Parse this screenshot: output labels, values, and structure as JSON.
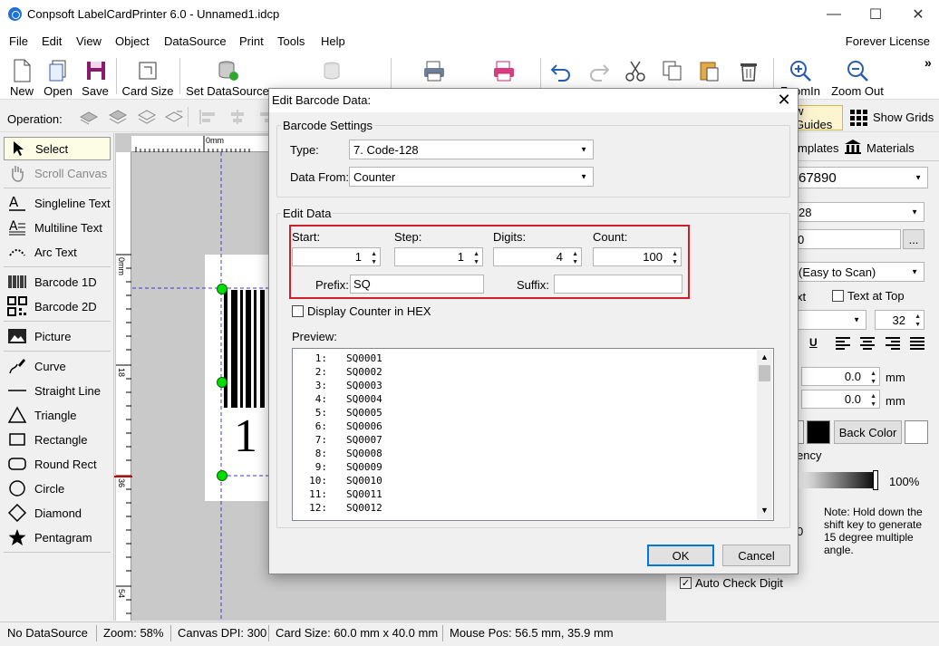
{
  "window": {
    "title": "Conpsoft LabelCardPrinter 6.0 - Unnamed1.idcp",
    "minimize": "—",
    "maximize": "☐",
    "close": "✕"
  },
  "menu": {
    "items": [
      "File",
      "Edit",
      "View",
      "Object",
      "DataSource",
      "Print",
      "Tools",
      "Help"
    ],
    "license": "Forever License"
  },
  "toolbar": {
    "new": "New",
    "open": "Open",
    "save": "Save",
    "card_size": "Card Size",
    "set_datasource": "Set DataSource",
    "zoom_in": "ZoomIn",
    "zoom_out": "Zoom Out",
    "overflow": "»"
  },
  "operation": {
    "label": "Operation:"
  },
  "tools": [
    {
      "label": "Select",
      "icon": "arrow-cursor-icon"
    },
    {
      "label": "Scroll Canvas",
      "icon": "hand-icon"
    },
    {
      "label": "Singleline Text",
      "icon": "singleline-text-icon"
    },
    {
      "label": "Multiline Text",
      "icon": "multiline-text-icon"
    },
    {
      "label": "Arc Text",
      "icon": "arc-text-icon"
    },
    {
      "label": "Barcode 1D",
      "icon": "barcode-icon"
    },
    {
      "label": "Barcode 2D",
      "icon": "qrcode-icon"
    },
    {
      "label": "Picture",
      "icon": "picture-icon"
    },
    {
      "label": "Curve",
      "icon": "curve-icon"
    },
    {
      "label": "Straight Line",
      "icon": "line-icon"
    },
    {
      "label": "Triangle",
      "icon": "triangle-icon"
    },
    {
      "label": "Rectangle",
      "icon": "rectangle-icon"
    },
    {
      "label": "Round Rect",
      "icon": "round-rect-icon"
    },
    {
      "label": "Circle",
      "icon": "circle-icon"
    },
    {
      "label": "Diamond",
      "icon": "diamond-icon"
    },
    {
      "label": "Pentagram",
      "icon": "star-icon"
    }
  ],
  "ruler": {
    "h_label": "0mm",
    "v_labels": [
      "0mm",
      "18",
      "36",
      "54"
    ]
  },
  "canvas": {
    "barcode_digit": "1"
  },
  "right_panel": {
    "show_guides": "w Guides",
    "show_grids": "Show Grids",
    "tab_templates": "mplates",
    "tab_materials": "Materials",
    "barcode_value": "67890",
    "combo_28": "28",
    "field_0": "0",
    "ellipsis": "...",
    "mode": "(Easy to Scan)",
    "text_below": "xt",
    "text_at_top": "Text at Top",
    "font_size": "32",
    "underline": "U",
    "x_value": "0.0",
    "y_value": "0.0",
    "unit": "mm",
    "back_color": "Back Color",
    "transparency": "ency",
    "transparency_pct": "100%",
    "side_digit": "0",
    "note": "Note: Hold down the shift key to generate 15 degree multiple angle.",
    "auto_check_digit": "Auto Check Digit"
  },
  "status": {
    "datasource": "No DataSource",
    "zoom": "Zoom: 58%",
    "dpi": "Canvas DPI: 300",
    "card_size": "Card Size: 60.0 mm x 40.0 mm",
    "mouse_pos": "Mouse Pos: 56.5 mm, 35.9 mm"
  },
  "dialog": {
    "title": "Edit Barcode Data:",
    "barcode_settings": "Barcode Settings",
    "type_label": "Type:",
    "type_value": "7.  Code-128",
    "data_from_label": "Data From:",
    "data_from_value": "Counter",
    "edit_data": "Edit Data",
    "start_label": "Start:",
    "start_value": "1",
    "step_label": "Step:",
    "step_value": "1",
    "digits_label": "Digits:",
    "digits_value": "4",
    "count_label": "Count:",
    "count_value": "100",
    "prefix_label": "Prefix:",
    "prefix_value": "SQ",
    "suffix_label": "Suffix:",
    "suffix_value": "",
    "hex_label": "Display Counter in HEX",
    "preview_label": "Preview:",
    "preview_rows": [
      {
        "n": "1:",
        "v": "SQ0001"
      },
      {
        "n": "2:",
        "v": "SQ0002"
      },
      {
        "n": "3:",
        "v": "SQ0003"
      },
      {
        "n": "4:",
        "v": "SQ0004"
      },
      {
        "n": "5:",
        "v": "SQ0005"
      },
      {
        "n": "6:",
        "v": "SQ0006"
      },
      {
        "n": "7:",
        "v": "SQ0007"
      },
      {
        "n": "8:",
        "v": "SQ0008"
      },
      {
        "n": "9:",
        "v": "SQ0009"
      },
      {
        "n": "10:",
        "v": "SQ0010"
      },
      {
        "n": "11:",
        "v": "SQ0011"
      },
      {
        "n": "12:",
        "v": "SQ0012"
      }
    ],
    "ok": "OK",
    "cancel": "Cancel"
  },
  "colors": {
    "highlight": "#d11f2a",
    "accent": "#0078d7",
    "guide": "#3b3bd6",
    "handle": "#00dd00"
  }
}
